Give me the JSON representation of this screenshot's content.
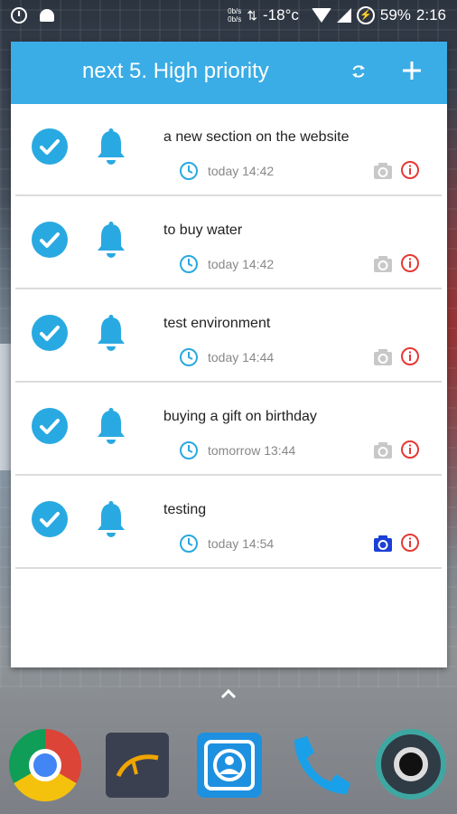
{
  "status_bar": {
    "net_up": "0b/s",
    "net_down": "0b/s",
    "temperature": "-18°c",
    "battery": "59%",
    "time": "2:16"
  },
  "widget": {
    "title": "next 5. High priority",
    "refresh_icon": "refresh-icon",
    "add_icon": "plus-icon",
    "accent_color": "#3aace6"
  },
  "tasks": [
    {
      "title": "a new section on the website",
      "time": "today 14:42",
      "camera_active": false
    },
    {
      "title": "to buy water",
      "time": "today 14:42",
      "camera_active": false
    },
    {
      "title": "test environment",
      "time": "today 14:44",
      "camera_active": false
    },
    {
      "title": "buying a gift on birthday",
      "time": "tomorrow 13:44",
      "camera_active": false
    },
    {
      "title": "testing",
      "time": "today 14:54",
      "camera_active": true
    }
  ],
  "dock": {
    "apps": [
      "chrome-icon",
      "navigation-app-icon",
      "gallery-app-icon",
      "phone-icon",
      "camera-app-icon"
    ]
  },
  "colors": {
    "check": "#29a9e1",
    "bell": "#29a9e1",
    "info": "#e53935",
    "camera_inactive": "#c8c8c8",
    "camera_active": "#1c3fd6"
  }
}
